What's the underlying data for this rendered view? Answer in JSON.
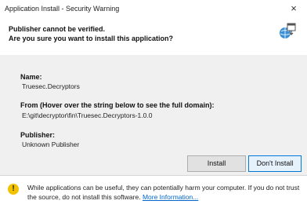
{
  "window": {
    "title": "Application Install - Security Warning",
    "close_glyph": "×"
  },
  "header": {
    "line1": "Publisher cannot be verified.",
    "line2": "Are you sure you want to install this application?",
    "icon": "application-install-icon"
  },
  "details": {
    "name_label": "Name:",
    "name_value": "Truesec.Decryptors",
    "from_label": "From (Hover over the string below to see the full domain):",
    "from_value": "E:\\git\\decryptor\\fin\\Truesec.Decryptors-1.0.0",
    "publisher_label": "Publisher:",
    "publisher_value": "Unknown Publisher"
  },
  "buttons": {
    "install": "Install",
    "dont_install": "Don't Install"
  },
  "footer": {
    "warning_icon": "warning-icon",
    "warning_glyph": "!",
    "message": "While applications can be useful, they can potentially harm your computer. If you do not trust the source, do not install this software.",
    "link": "More Information..."
  },
  "colors": {
    "panel_bg": "#f0f0f0",
    "link": "#0066cc",
    "warning": "#f2c200",
    "focus_border": "#0078d7"
  }
}
